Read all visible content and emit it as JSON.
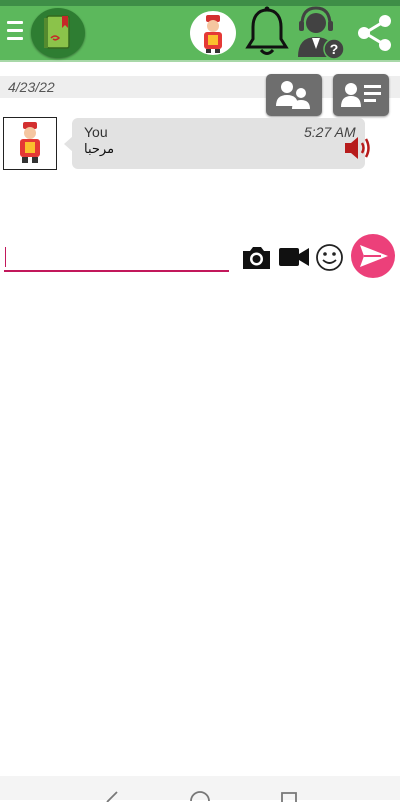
{
  "app_bar": {
    "background": "#5cb85c",
    "menu_icon": "hamburger-icon",
    "logo_icon": "book-logo-icon",
    "profile_icon": "avatar-icon",
    "notifications_icon": "bell-icon",
    "support_icon": "support-agent-icon",
    "share_icon": "share-icon"
  },
  "chat": {
    "date": "4/23/22",
    "group_button_icon": "group-users-icon",
    "contact_button_icon": "contact-card-icon",
    "messages": [
      {
        "sender": "You",
        "time": "5:27 AM",
        "text": "مرحبا",
        "audio_icon": "speaker-icon",
        "audio_color": "#b71c1c"
      }
    ]
  },
  "composer": {
    "input_value": "",
    "accent": "#c2185b",
    "camera_icon": "camera-icon",
    "video_icon": "video-camera-icon",
    "emoji_icon": "emoji-icon",
    "send_icon": "send-icon",
    "send_color": "#ec407a"
  },
  "system_nav": {
    "back_icon": "back-triangle-icon",
    "home_icon": "home-circle-icon",
    "recent_icon": "recent-square-icon"
  }
}
